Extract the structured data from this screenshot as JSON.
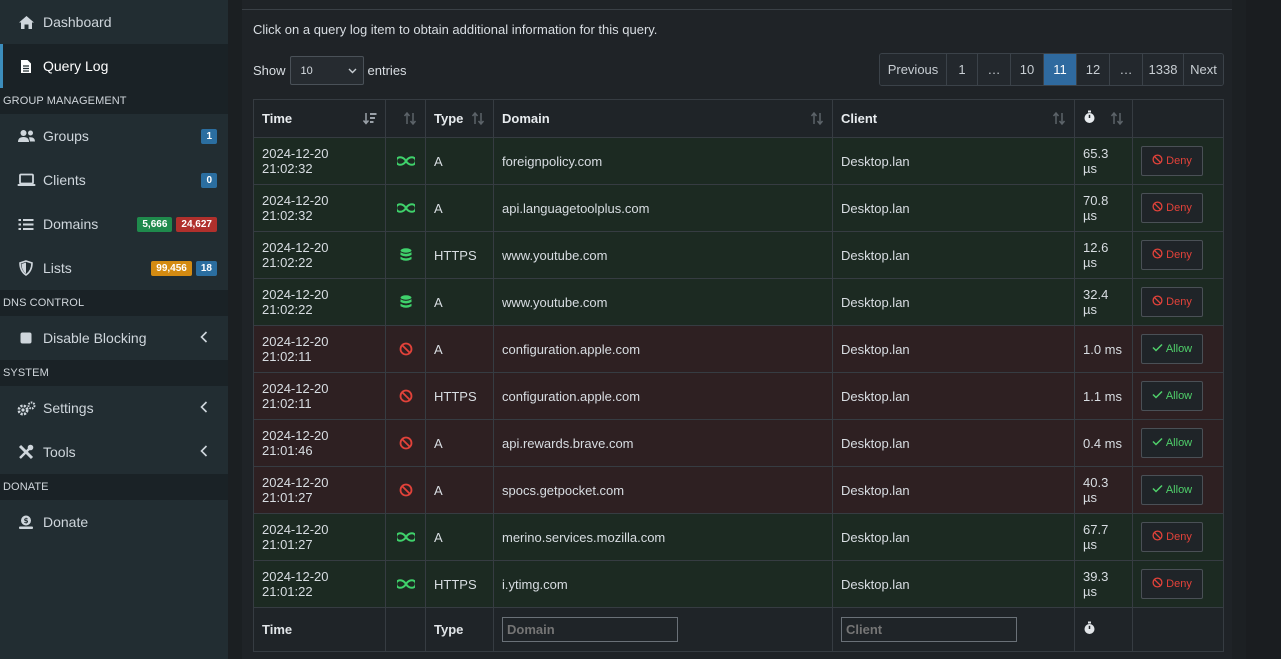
{
  "sidebar": {
    "items": [
      {
        "label": "Dashboard"
      },
      {
        "label": "Query Log"
      }
    ],
    "group_header": "GROUP MANAGEMENT",
    "groups": {
      "label": "Groups",
      "badge": "1"
    },
    "clients": {
      "label": "Clients",
      "badge": "0"
    },
    "domains": {
      "label": "Domains",
      "badge_allow": "5,666",
      "badge_deny": "24,627"
    },
    "lists": {
      "label": "Lists",
      "badge_a": "99,456",
      "badge_b": "18"
    },
    "dns_header": "DNS CONTROL",
    "disable_blocking": {
      "label": "Disable Blocking"
    },
    "system_header": "SYSTEM",
    "settings": {
      "label": "Settings"
    },
    "tools": {
      "label": "Tools"
    },
    "donate_header": "DONATE",
    "donate": {
      "label": "Donate"
    }
  },
  "main": {
    "info_text": "Click on a query log item to obtain additional information for this query.",
    "show_label": "Show",
    "entries_value": "10",
    "entries_label": "entries",
    "pagination": [
      "Previous",
      "1",
      "…",
      "10",
      "11",
      "12",
      "…",
      "1338",
      "Next"
    ],
    "current_page": "11",
    "columns": {
      "time": "Time",
      "type": "Type",
      "domain": "Domain",
      "client": "Client"
    },
    "footer": {
      "time": "Time",
      "type": "Type",
      "domain_placeholder": "Domain",
      "client_placeholder": "Client"
    },
    "rows": [
      {
        "time": "2024-12-20 21:02:32",
        "status": "forwarded",
        "type": "A",
        "domain": "foreignpolicy.com",
        "client": "Desktop.lan",
        "reply": "65.3 µs",
        "action": "Deny"
      },
      {
        "time": "2024-12-20 21:02:32",
        "status": "forwarded",
        "type": "A",
        "domain": "api.languagetoolplus.com",
        "client": "Desktop.lan",
        "reply": "70.8 µs",
        "action": "Deny"
      },
      {
        "time": "2024-12-20 21:02:22",
        "status": "cached",
        "type": "HTTPS",
        "domain": "www.youtube.com",
        "client": "Desktop.lan",
        "reply": "12.6 µs",
        "action": "Deny"
      },
      {
        "time": "2024-12-20 21:02:22",
        "status": "cached",
        "type": "A",
        "domain": "www.youtube.com",
        "client": "Desktop.lan",
        "reply": "32.4 µs",
        "action": "Deny"
      },
      {
        "time": "2024-12-20 21:02:11",
        "status": "blocked",
        "type": "A",
        "domain": "configuration.apple.com",
        "client": "Desktop.lan",
        "reply": "1.0 ms",
        "action": "Allow"
      },
      {
        "time": "2024-12-20 21:02:11",
        "status": "blocked",
        "type": "HTTPS",
        "domain": "configuration.apple.com",
        "client": "Desktop.lan",
        "reply": "1.1 ms",
        "action": "Allow"
      },
      {
        "time": "2024-12-20 21:01:46",
        "status": "blocked",
        "type": "A",
        "domain": "api.rewards.brave.com",
        "client": "Desktop.lan",
        "reply": "0.4 ms",
        "action": "Allow"
      },
      {
        "time": "2024-12-20 21:01:27",
        "status": "blocked",
        "type": "A",
        "domain": "spocs.getpocket.com",
        "client": "Desktop.lan",
        "reply": "40.3 µs",
        "action": "Allow"
      },
      {
        "time": "2024-12-20 21:01:27",
        "status": "forwarded",
        "type": "A",
        "domain": "merino.services.mozilla.com",
        "client": "Desktop.lan",
        "reply": "67.7 µs",
        "action": "Deny"
      },
      {
        "time": "2024-12-20 21:01:22",
        "status": "forwarded",
        "type": "HTTPS",
        "domain": "i.ytimg.com",
        "client": "Desktop.lan",
        "reply": "39.3 µs",
        "action": "Deny"
      }
    ]
  },
  "colors": {
    "forwarded": "#3fd16b",
    "cached": "#3fd16b",
    "blocked": "#e2423a",
    "accent": "#3c8dbc"
  }
}
